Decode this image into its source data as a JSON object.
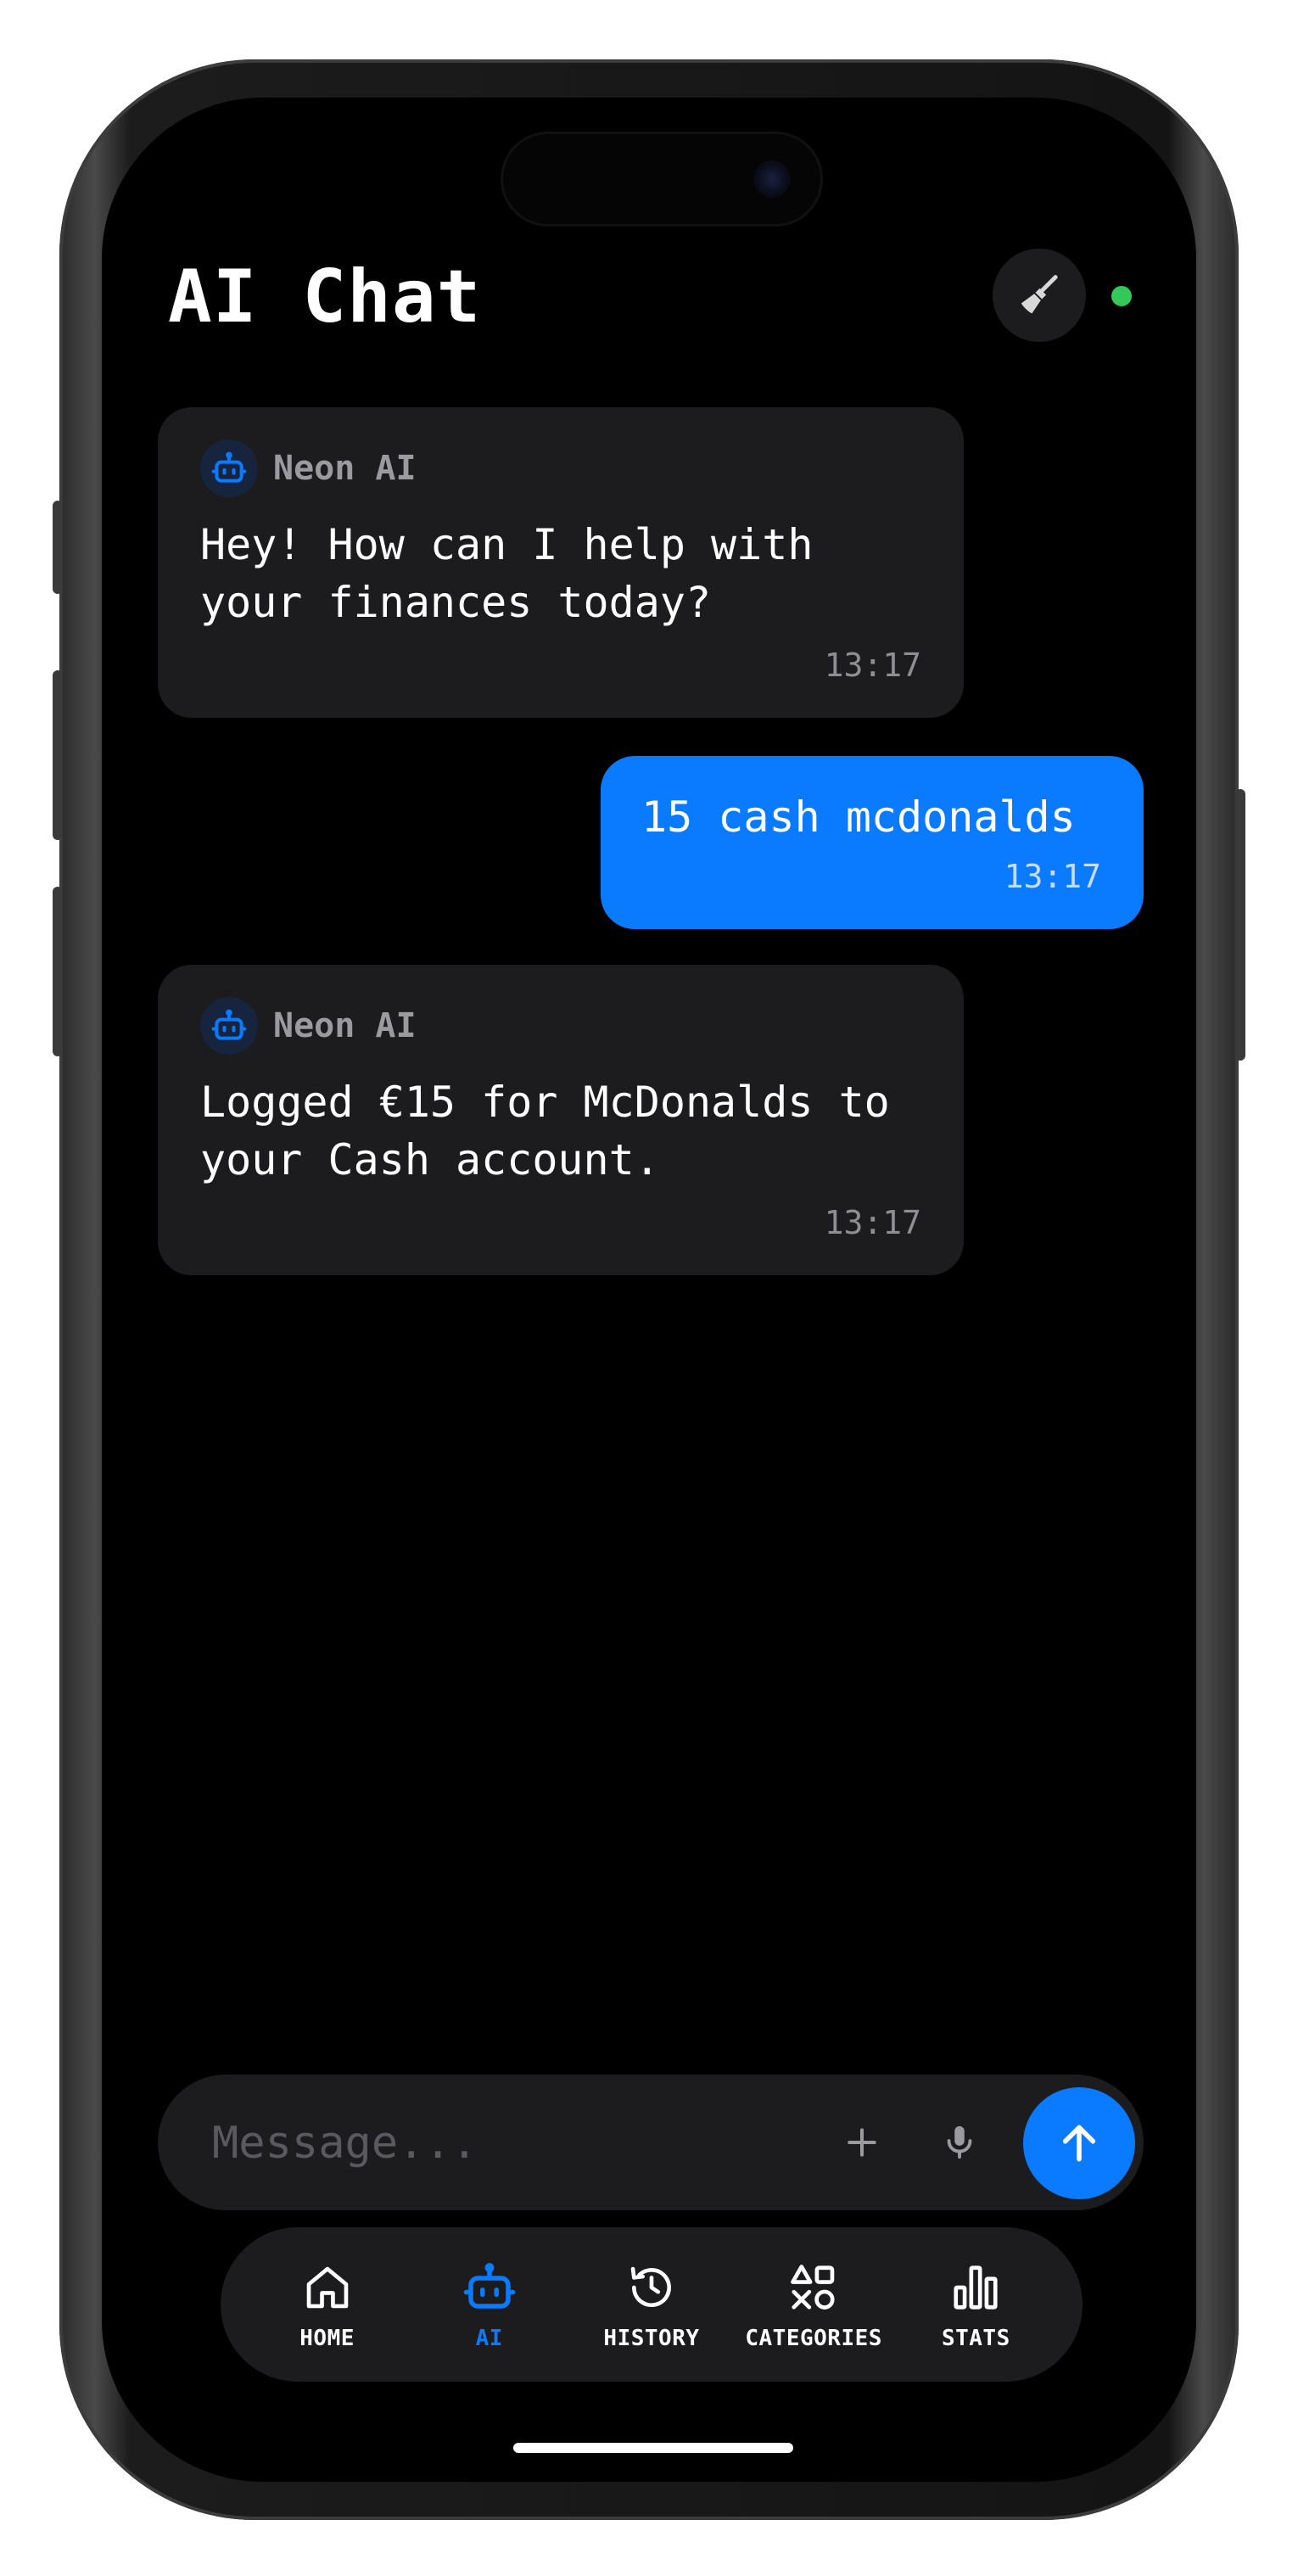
{
  "header": {
    "title": "AI Chat",
    "clear_icon": "broom-icon",
    "status_color": "#34c759"
  },
  "messages": [
    {
      "role": "assistant",
      "sender": "Neon AI",
      "avatar_icon": "robot-icon",
      "text": "Hey! How can I help with\nyour finances today?",
      "time": "13:17"
    },
    {
      "role": "user",
      "text": "15 cash mcdonalds",
      "time": "13:17"
    },
    {
      "role": "assistant",
      "sender": "Neon AI",
      "avatar_icon": "robot-icon",
      "text": "Logged €15 for McDonalds to\nyour Cash account.",
      "time": "13:17"
    }
  ],
  "composer": {
    "placeholder": "Message...",
    "value": "",
    "attach_icon": "plus-icon",
    "mic_icon": "microphone-icon",
    "send_icon": "arrow-up-icon"
  },
  "tabs": [
    {
      "label": "HOME",
      "icon": "home-icon",
      "active": false
    },
    {
      "label": "AI",
      "icon": "robot-icon",
      "active": true
    },
    {
      "label": "HISTORY",
      "icon": "history-icon",
      "active": false
    },
    {
      "label": "CATEGORIES",
      "icon": "shapes-icon",
      "active": false
    },
    {
      "label": "STATS",
      "icon": "bar-chart-icon",
      "active": false
    }
  ],
  "colors": {
    "accent": "#0a7aff",
    "surface": "#1c1c1e",
    "background": "#000000"
  }
}
